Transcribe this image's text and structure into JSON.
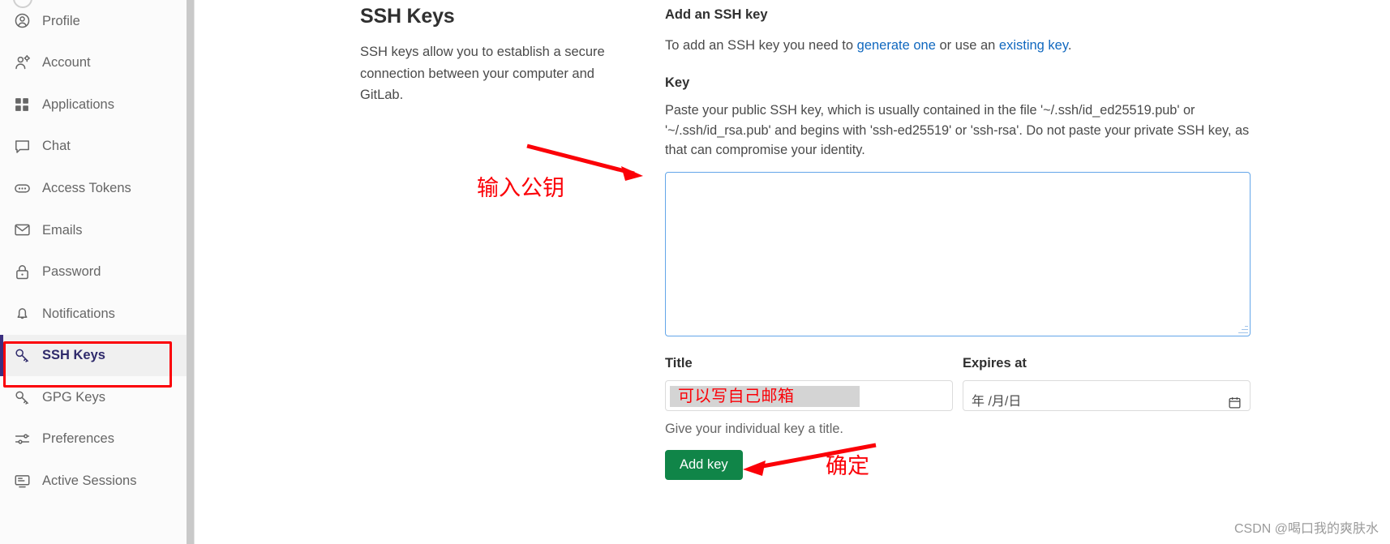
{
  "sidebar": {
    "items": [
      {
        "label": "Profile",
        "icon": "user-circle-icon",
        "active": false
      },
      {
        "label": "Account",
        "icon": "user-settings-icon",
        "active": false
      },
      {
        "label": "Applications",
        "icon": "grid-apps-icon",
        "active": false
      },
      {
        "label": "Chat",
        "icon": "chat-bubble-icon",
        "active": false
      },
      {
        "label": "Access Tokens",
        "icon": "token-icon",
        "active": false
      },
      {
        "label": "Emails",
        "icon": "envelope-icon",
        "active": false
      },
      {
        "label": "Password",
        "icon": "lock-icon",
        "active": false
      },
      {
        "label": "Notifications",
        "icon": "bell-icon",
        "active": false
      },
      {
        "label": "SSH Keys",
        "icon": "key-icon",
        "active": true
      },
      {
        "label": "GPG Keys",
        "icon": "key-icon",
        "active": false
      },
      {
        "label": "Preferences",
        "icon": "sliders-icon",
        "active": false
      },
      {
        "label": "Active Sessions",
        "icon": "monitor-icon",
        "active": false
      }
    ]
  },
  "left_column": {
    "title": "SSH Keys",
    "description": "SSH keys allow you to establish a secure connection between your computer and GitLab."
  },
  "right_column": {
    "heading": "Add an SSH key",
    "intro_prefix": "To add an SSH key you need to ",
    "link_generate": "generate one",
    "intro_middle": " or use an ",
    "link_existing": "existing key",
    "intro_suffix": ".",
    "key_label": "Key",
    "key_help": "Paste your public SSH key, which is usually contained in the file '~/.ssh/id_ed25519.pub' or '~/.ssh/id_rsa.pub' and begins with 'ssh-ed25519' or 'ssh-rsa'. Do not paste your private SSH key, as that can compromise your identity.",
    "key_textarea_value": "",
    "title_label": "Title",
    "title_value": "可以写自己邮箱",
    "title_hint": "Give your individual key a title.",
    "expires_label": "Expires at",
    "expires_placeholder": "年 /月/日",
    "calendar_icon": "calendar-icon",
    "submit_label": "Add key"
  },
  "annotations": {
    "key_note": "输入公钥",
    "confirm_note": "确定",
    "color": "#fb0007"
  },
  "watermark": "CSDN @喝口我的爽肤水",
  "colors": {
    "accent_link": "#1068bf",
    "submit_green": "#108548",
    "active_nav": "#2f2a6b",
    "annotation_red": "#fb0007"
  }
}
